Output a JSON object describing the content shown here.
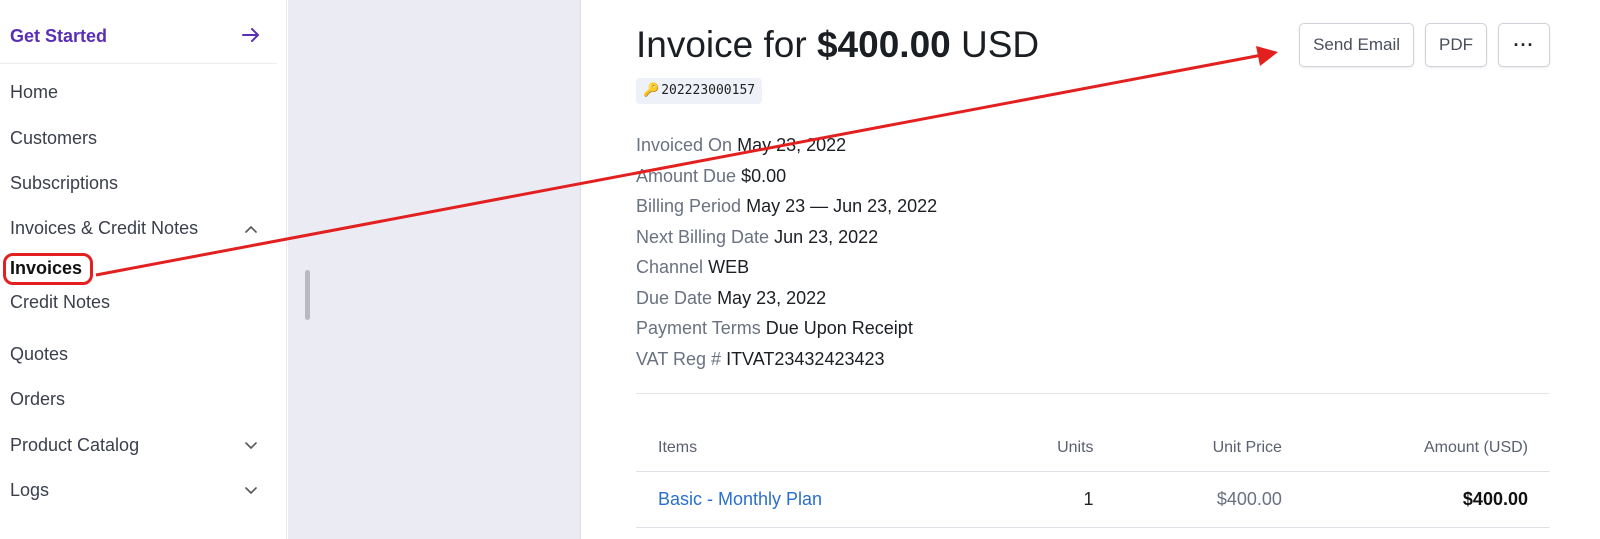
{
  "sidebar": {
    "get_started": "Get Started",
    "items": [
      {
        "label": "Home"
      },
      {
        "label": "Customers"
      },
      {
        "label": "Subscriptions"
      },
      {
        "label": "Invoices & Credit Notes"
      },
      {
        "label": "Invoices"
      },
      {
        "label": "Credit Notes"
      },
      {
        "label": "Quotes"
      },
      {
        "label": "Orders"
      },
      {
        "label": "Product Catalog"
      },
      {
        "label": "Logs"
      }
    ]
  },
  "invoice": {
    "title_prefix": "Invoice for",
    "amount": "$400.00",
    "currency": "USD",
    "id": "202223000157",
    "details": [
      {
        "label": "Invoiced On",
        "value": "May 23, 2022"
      },
      {
        "label": "Amount Due",
        "value": "$0.00"
      },
      {
        "label": "Billing Period",
        "value": "May 23 — Jun 23, 2022"
      },
      {
        "label": "Next Billing Date",
        "value": "Jun 23, 2022"
      },
      {
        "label": "Channel",
        "value": "WEB"
      },
      {
        "label": "Due Date",
        "value": "May 23, 2022"
      },
      {
        "label": "Payment Terms",
        "value": "Due Upon Receipt"
      },
      {
        "label": "VAT Reg #",
        "value": "ITVAT23432423423"
      }
    ]
  },
  "toolbar": {
    "send_email": "Send Email",
    "pdf": "PDF",
    "more": "···"
  },
  "table": {
    "headers": [
      "Items",
      "Units",
      "Unit Price",
      "Amount (USD)"
    ],
    "rows": [
      {
        "item": "Basic - Monthly Plan",
        "units": "1",
        "unit_price": "$400.00",
        "amount": "$400.00"
      }
    ]
  },
  "colors": {
    "accent": "#5b2fb5",
    "link": "#2a6fcf",
    "annotation": "#e32020"
  }
}
